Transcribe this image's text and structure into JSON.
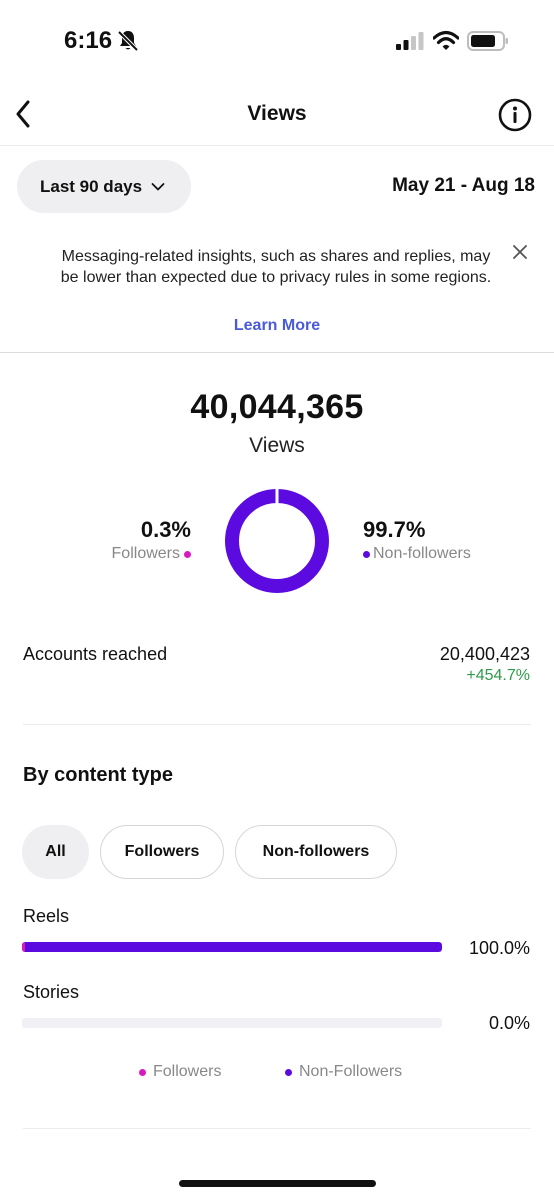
{
  "status_bar": {
    "time": "6:16"
  },
  "header": {
    "title": "Views"
  },
  "filter": {
    "range_label": "Last 90 days",
    "date_range": "May 21 - Aug 18"
  },
  "notice": {
    "text": "Messaging-related insights, such as shares and replies, may be lower than expected due to privacy rules in some regions.",
    "link": "Learn More"
  },
  "summary": {
    "total": "40,044,365",
    "total_label": "Views",
    "followers_pct": "0.3%",
    "followers_label": "Followers",
    "nonfollowers_pct": "99.7%",
    "nonfollowers_label": "Non-followers",
    "followers_fraction": 0.003
  },
  "reach": {
    "label": "Accounts reached",
    "value": "20,400,423",
    "change": "+454.7%"
  },
  "content_type": {
    "title": "By content type",
    "chips": [
      "All",
      "Followers",
      "Non-followers"
    ],
    "rows": [
      {
        "label": "Reels",
        "pct": "100.0%",
        "fraction": 1.0
      },
      {
        "label": "Stories",
        "pct": "0.0%",
        "fraction": 0.0
      }
    ],
    "legend": [
      "Followers",
      "Non-Followers"
    ]
  },
  "colors": {
    "followers": "#d81bbf",
    "nonfollowers": "#5b0be0",
    "positive": "#2e9a4a",
    "link": "#4a5bd8"
  },
  "icons": [
    "bell-slash-icon",
    "signal-icon",
    "wifi-icon",
    "battery-icon",
    "back-icon",
    "info-icon",
    "chevron-down-icon",
    "close-icon"
  ]
}
